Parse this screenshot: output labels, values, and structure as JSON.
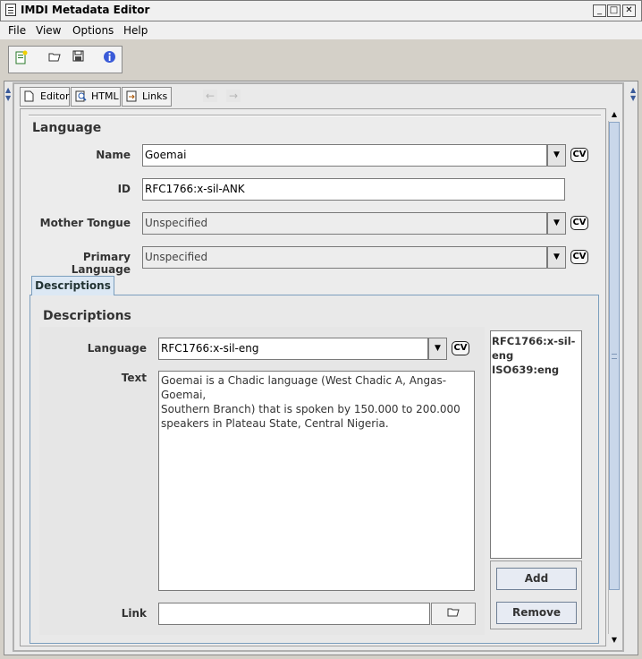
{
  "window": {
    "title": "IMDI Metadata Editor",
    "controls": [
      "_",
      "□",
      "✕"
    ]
  },
  "menu": [
    {
      "label": "File"
    },
    {
      "label": "View"
    },
    {
      "label": "Options"
    },
    {
      "label": "Help"
    }
  ],
  "toolbar": {
    "icons": [
      "new-document-icon",
      "open-folder-icon",
      "save-icon",
      "info-icon"
    ]
  },
  "view_tabs": [
    {
      "label": "Editor",
      "icon": "document-icon"
    },
    {
      "label": "HTML",
      "icon": "search-icon"
    },
    {
      "label": "Links",
      "icon": "links-icon"
    }
  ],
  "nav": {
    "back": "←",
    "forward": "→"
  },
  "language": {
    "section_title": "Language",
    "name_label": "Name",
    "name_value": "Goemai",
    "id_label": "ID",
    "id_value": "RFC1766:x-sil-ANK",
    "mother_tongue_label": "Mother Tongue",
    "mother_tongue_value": "Unspecified",
    "primary_language_label": "Primary Language",
    "primary_language_value": "Unspecified",
    "cv_label": "CV"
  },
  "descriptions": {
    "tab_label": "Descriptions",
    "section_title": "Descriptions",
    "language_label": "Language",
    "language_value": "RFC1766:x-sil-eng",
    "text_label": "Text",
    "text_value": "Goemai is a Chadic language (West Chadic A, Angas-Goemai,\nSouthern Branch) that is spoken by 150.000 to 200.000\nspeakers in Plateau State, Central Nigeria.",
    "link_label": "Link",
    "link_value": "",
    "list_items": [
      "RFC1766:x-sil-eng",
      "ISO639:eng"
    ],
    "add_label": "Add",
    "remove_label": "Remove"
  }
}
